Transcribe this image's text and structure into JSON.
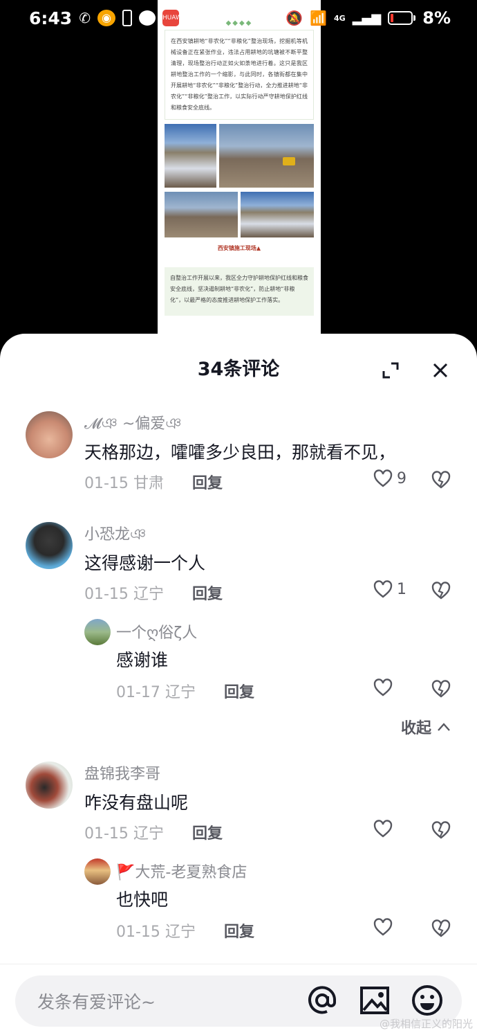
{
  "status_bar": {
    "time": "6:43",
    "battery": "8%",
    "network": "4G",
    "app_badge": "HUAWEI"
  },
  "article": {
    "paragraph1": "在西安镇耕地“非农化”“非粮化”整治现场，挖掘机等机械设备正在紧张作业，违法占用耕地的坑塘被不断平整清理，现场整治行动正如火如荼地进行着。这只是我区耕地整治工作的一个缩影，与此同时，各镇街都在集中开展耕地“非农化”“非粮化”整治行动，全力推进耕地“非农化”“非粮化”整治工作，以实际行动严守耕地保护红线和粮食安全底线。",
    "caption": "西安镇施工现场▲",
    "paragraph2": "自整治工作开展以来，我区全力守护耕地保护红线和粮食安全底线，坚决遏制耕地“非农化”，防止耕地“非粮化”，以最严格的态度推进耕地保护工作落实。"
  },
  "sheet": {
    "title": "34条评论"
  },
  "comments": [
    {
      "user": "𝓜ঞ ~偏爱ঞ",
      "text": "天格那边，嚯嚯多少良田，那就看不见，",
      "date": "01-15",
      "region": "甘肃",
      "reply": "回复",
      "likes": "9"
    },
    {
      "user": "小恐龙ঞ",
      "text": "这得感谢一个人",
      "date": "01-15",
      "region": "辽宁",
      "reply": "回复",
      "likes": "1"
    },
    {
      "user": "一个ღ俗ζ人",
      "text": "感谢谁",
      "date": "01-17",
      "region": "辽宁",
      "reply": "回复",
      "likes": ""
    },
    {
      "user": "盘锦我李哥",
      "text": "咋没有盘山呢",
      "date": "01-15",
      "region": "辽宁",
      "reply": "回复",
      "likes": ""
    },
    {
      "user": "🚩大荒-老夏熟食店",
      "text": "也快吧",
      "date": "01-15",
      "region": "辽宁",
      "reply": "回复",
      "likes": ""
    }
  ],
  "collapse_label": "收起",
  "input": {
    "placeholder": "发条有爱评论~"
  },
  "watermark": "@我相信正义的阳光"
}
